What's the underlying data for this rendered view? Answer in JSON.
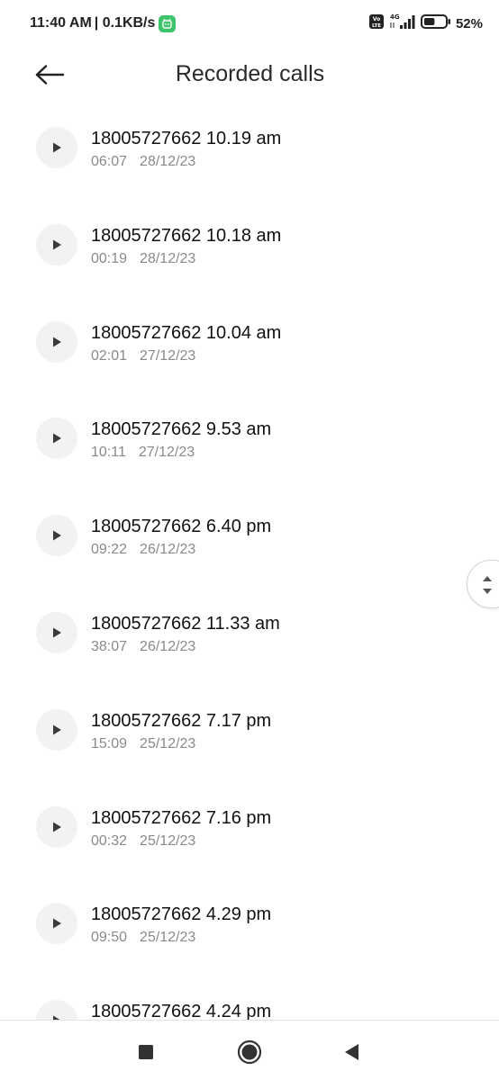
{
  "status_bar": {
    "time": "11:40 AM",
    "speed": "| 0.1KB/s",
    "network": "4G",
    "volte": "Vo LTE",
    "battery_percent": "52%",
    "battery_level": 0.52
  },
  "header": {
    "title": "Recorded calls"
  },
  "recordings": [
    {
      "title": "18005727662 10.19 am",
      "duration": "06:07",
      "date": "28/12/23"
    },
    {
      "title": "18005727662 10.18 am",
      "duration": "00:19",
      "date": "28/12/23"
    },
    {
      "title": "18005727662 10.04 am",
      "duration": "02:01",
      "date": "27/12/23"
    },
    {
      "title": "18005727662 9.53 am",
      "duration": "10:11",
      "date": "27/12/23"
    },
    {
      "title": "18005727662 6.40 pm",
      "duration": "09:22",
      "date": "26/12/23"
    },
    {
      "title": "18005727662 11.33 am",
      "duration": "38:07",
      "date": "26/12/23"
    },
    {
      "title": "18005727662 7.17 pm",
      "duration": "15:09",
      "date": "25/12/23"
    },
    {
      "title": "18005727662 7.16 pm",
      "duration": "00:32",
      "date": "25/12/23"
    },
    {
      "title": "18005727662 4.29 pm",
      "duration": "09:50",
      "date": "25/12/23"
    },
    {
      "title": "18005727662 4.24 pm",
      "duration": "",
      "date": ""
    }
  ],
  "nav": {
    "buttons": [
      "recents-square",
      "home-circle",
      "back-triangle"
    ]
  },
  "colors": {
    "accent_notification": "#3dc36b",
    "play_button_bg": "#f2f2f2",
    "meta_text": "#8a8a8a"
  }
}
